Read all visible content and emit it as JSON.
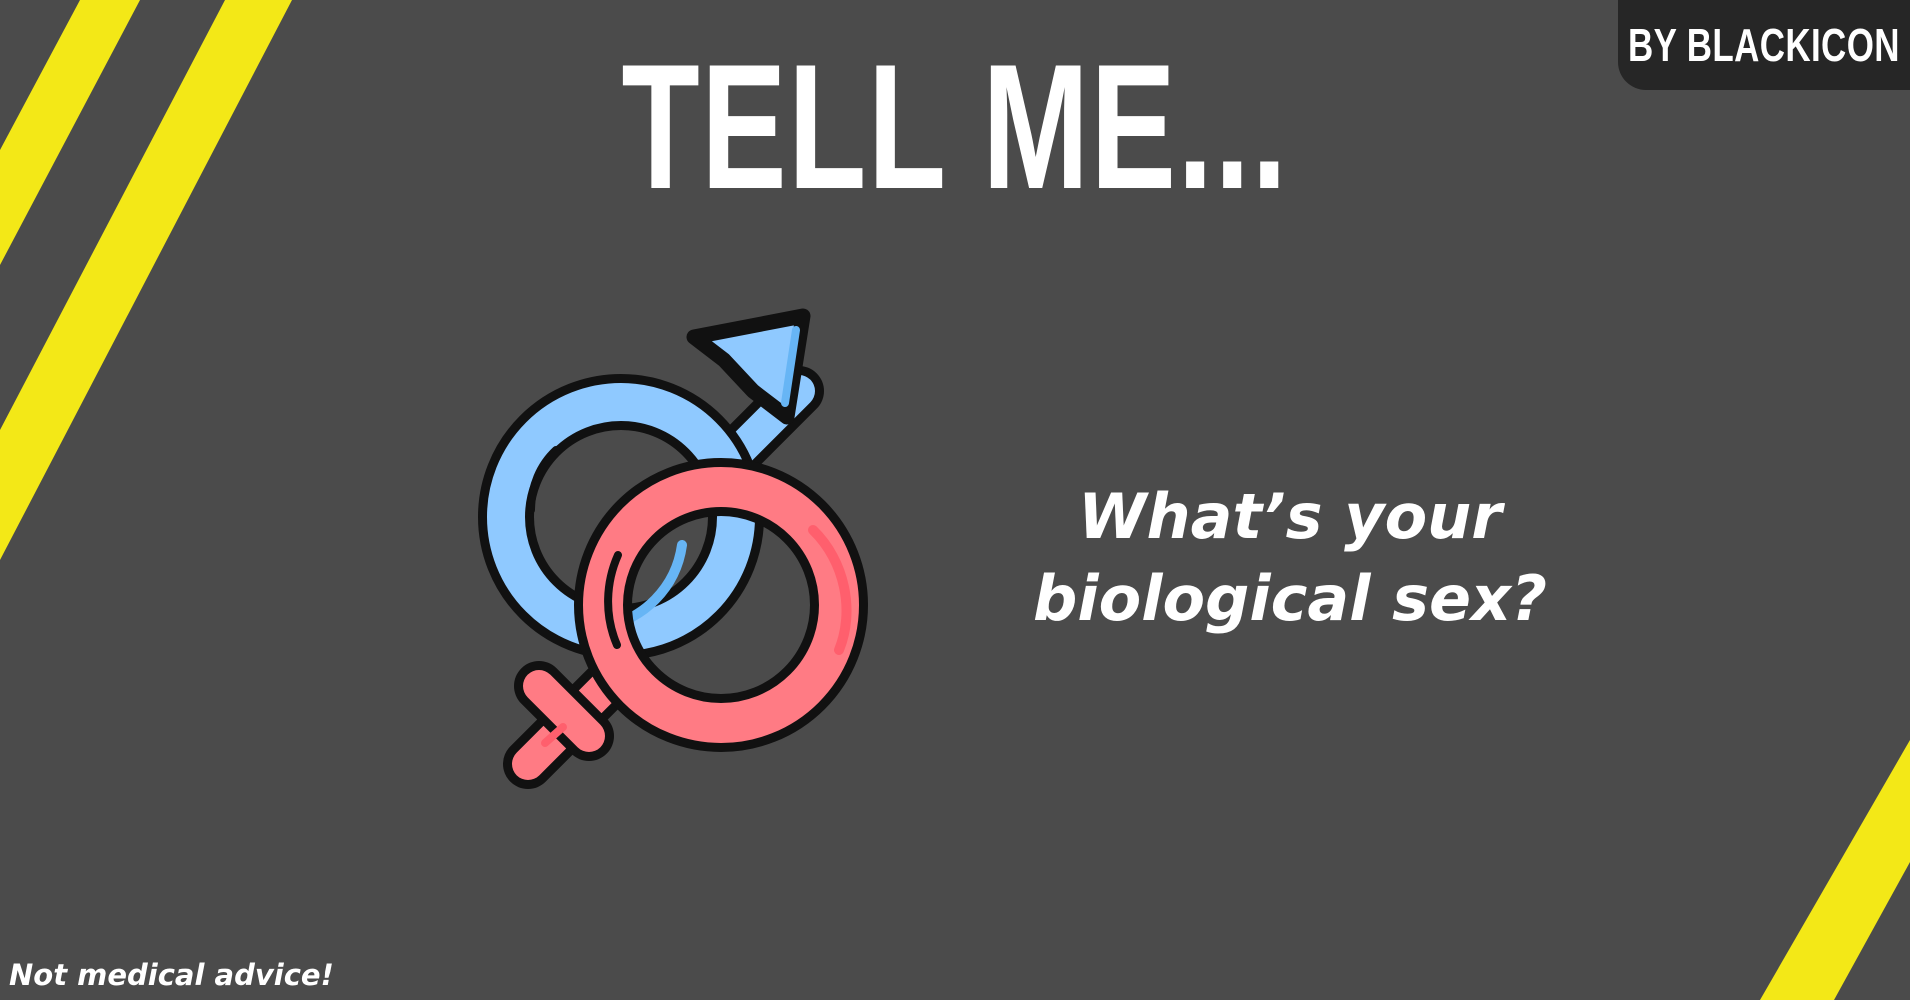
{
  "colors": {
    "background": "#4b4b4b",
    "stripe": "#f3e817",
    "badge": "#262626",
    "text": "#ffffff",
    "male_symbol": "#8fc9ff",
    "female_symbol": "#ff7b84",
    "outline": "#111111"
  },
  "header": {
    "title": "TELL ME..."
  },
  "badge": {
    "text": "BY BLACKICON"
  },
  "main": {
    "icon": "intertwined-male-female-symbols-icon",
    "question_line_1": "What’s your",
    "question_line_2": "biological sex?"
  },
  "footer": {
    "note": "Not medical advice!"
  }
}
